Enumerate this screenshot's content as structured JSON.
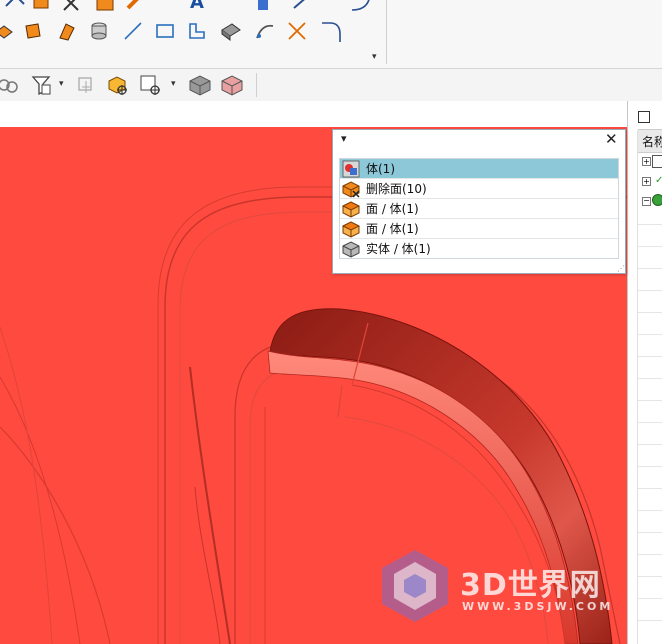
{
  "selection_popup": {
    "items": [
      {
        "label": "体(1)",
        "icon": "body-selection-icon",
        "selected": true
      },
      {
        "label": "删除面(10)",
        "icon": "delete-face-icon",
        "selected": false
      },
      {
        "label": "面 / 体(1)",
        "icon": "face-icon",
        "selected": false
      },
      {
        "label": "面 / 体(1)",
        "icon": "face-icon",
        "selected": false
      },
      {
        "label": "实体 / 体(1)",
        "icon": "solid-body-icon",
        "selected": false
      }
    ],
    "collapse_glyph": "▾",
    "close_glyph": "✕"
  },
  "right_panel": {
    "header_label": "名称"
  },
  "watermark": {
    "text": "3D世界网",
    "subtext": "WWW.3DSJW.COM"
  },
  "colors": {
    "viewport_background": "#ff4a3f",
    "selection_highlight": "#8cc8d8",
    "viewport_border": "#1b6b8c"
  }
}
